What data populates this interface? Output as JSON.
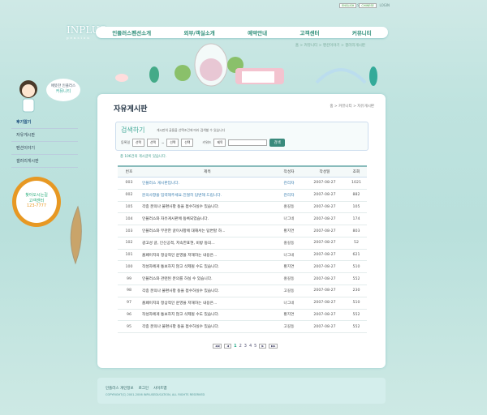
{
  "topnav": {
    "home": "Home",
    "sitemap": "SITEMAP",
    "login": "LOGIN",
    "english": "ENGLISH",
    "chinese": "CHINESE"
  },
  "logo": {
    "name": "INPLUS",
    "sub": "pension"
  },
  "menu": [
    "인플러스펜션소개",
    "외부/객실소개",
    "예약안내",
    "고객센터",
    "커뮤니티"
  ],
  "subnav": "홈 > 커뮤니티 > 펜션이야기 > 갤러리게시판",
  "sidebar": {
    "bubble_line1": "애뜻한 인플러스",
    "bubble_line2": "커뮤니티",
    "items": [
      "후기알기",
      "자유게시판",
      "펜션이야기",
      "갤러리게시판"
    ],
    "sign_line1": "찾아오시는길",
    "sign_line2": "고객센터",
    "sign_phone": "123-7777"
  },
  "page": {
    "title": "자유게시판",
    "breadcrumb": "홈 > 커뮤니티 > 자유게시판"
  },
  "search": {
    "title": "검색하기",
    "desc": "게시판의 글들을 선택조건에 따라 검색할 수 있습니다",
    "label_period": "등록일",
    "sel1": "선택",
    "sel2": "선택",
    "sel3": "선택",
    "sel4": "선택",
    "label_keyword": "키워드",
    "sel5": "제목",
    "button": "검색"
  },
  "count": "총 106건의 게시글이 있습니다.",
  "table": {
    "headers": [
      "번호",
      "제목",
      "작성자",
      "작성일",
      "조회"
    ],
    "rows": [
      [
        "003",
        "인플러스 게시판입니다.",
        "관리자",
        "2007-08-27",
        "1021"
      ],
      [
        "002",
        "문의사항을 입력해주세요.친절히 답변해 드립니다.",
        "관리자",
        "2007-08-27",
        "882"
      ],
      [
        "105",
        "각종 문의나 불편사항 등을 접수하실수 있습니다.",
        "홍길동",
        "2007-08-27",
        "105"
      ],
      [
        "104",
        "인플러스와 자유게시판에 등록되었습니다.",
        "나그네",
        "2007-08-27",
        "174"
      ],
      [
        "103",
        "인플러스와 무관한 글이사항에 대해서는 답변할 하...",
        "황지연",
        "2007-08-27",
        "803"
      ],
      [
        "102",
        "광고성 글, 인신공격, 저속한표현, 비방 등의...",
        "홍길동",
        "2007-08-27",
        "52"
      ],
      [
        "101",
        "홈페이지의 정상적인 운영을 저해하는 내용은...",
        "나그네",
        "2007-08-27",
        "621"
      ],
      [
        "100",
        "작성자에게 통보하지 않고 삭제될 수도 있습니다.",
        "황지연",
        "2007-08-27",
        "510"
      ],
      [
        "99",
        "인플러스와 관련된 문의를 하실 수 있습니다.",
        "홍길동",
        "2007-08-27",
        "552"
      ],
      [
        "98",
        "각종 문의나 불편사항 등을 접수하실수 있습니다.",
        "고길동",
        "2007-08-27",
        "230"
      ],
      [
        "97",
        "홈페이지의 정상적인 운영을 저해하는 내용은...",
        "나그네",
        "2007-08-27",
        "510"
      ],
      [
        "96",
        "작성자에게 통보하지 않고 삭제될 수도 있습니다.",
        "황지연",
        "2007-08-27",
        "552"
      ],
      [
        "95",
        "각종 문의나 불편사항 등을 접수하실수 있습니다.",
        "고길동",
        "2007-08-27",
        "552"
      ]
    ]
  },
  "pager": {
    "pages": [
      "1",
      "2",
      "3",
      "4",
      "5"
    ],
    "current": "1"
  },
  "footer": {
    "link1": "인플러스 개인정보",
    "link2": "로그인",
    "link3": "사이트맵",
    "copyright": "COPYRIGHT(C) 2001-2006 INPLUSEDUCATION, ALL RIGHTS RESERVED"
  }
}
